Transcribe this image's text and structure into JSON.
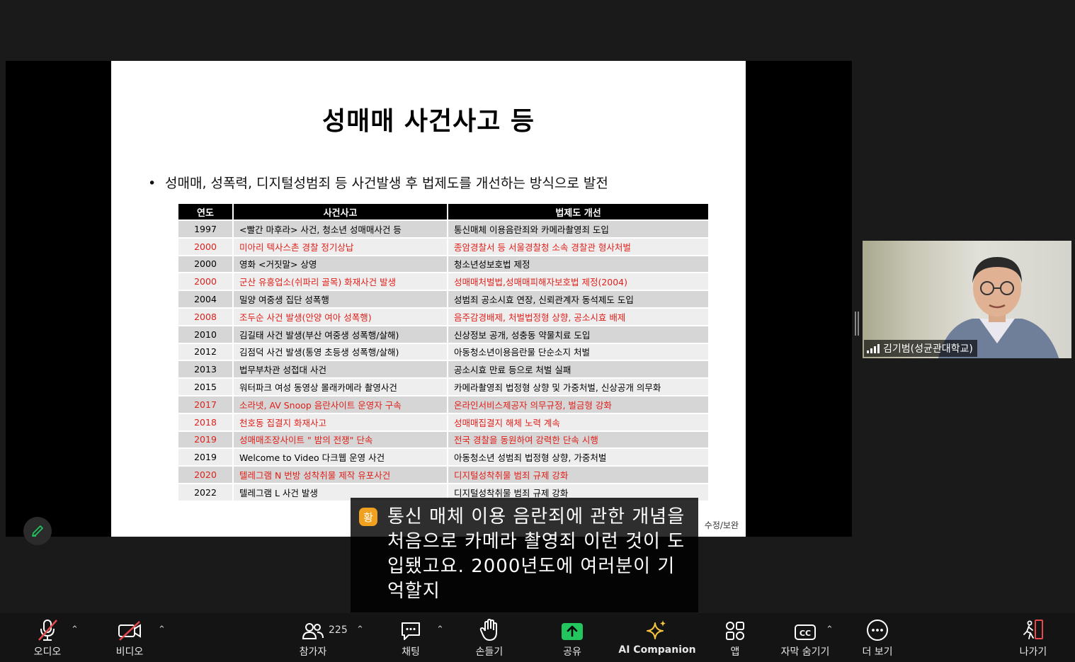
{
  "slide": {
    "title": "성매매 사건사고 등",
    "bullet": "성매매, 성폭력, 디지털성범죄 등 사건발생 후 법제도를 개선하는 방식으로 발전",
    "headers": [
      "연도",
      "사건사고",
      "법제도 개선"
    ],
    "rows": [
      {
        "year": "1997",
        "event": "<빨간 마후라> 사건, 청소년 성매매사건 등",
        "reform": "통신매체 이용음란죄와 카메라촬영죄 도입",
        "highlight": false
      },
      {
        "year": "2000",
        "event": "미아리 텍사스촌 경찰 정기상납",
        "reform": "종암경찰서 등 서울경찰청 소속 경찰관 형사처벌",
        "highlight": true
      },
      {
        "year": "2000",
        "event": "영화 <거짓말> 상영",
        "reform": "청소년성보호법 제정",
        "highlight": false
      },
      {
        "year": "2000",
        "event": "군산 유흥업소(쉬파리 골목) 화재사건 발생",
        "reform": "성매매처벌법,성매매피해자보호법 제정(2004)",
        "highlight": true
      },
      {
        "year": "2004",
        "event": "밀양 여중생 집단 성폭행",
        "reform": "성범죄 공소시효 연장, 신뢰관계자 동석제도  도입",
        "highlight": false
      },
      {
        "year": "2008",
        "event": "조두순 사건 발생(안양 여아 성폭행)",
        "reform": "음주감경배제, 처벌법정형 상향, 공소시효 배제",
        "highlight": true
      },
      {
        "year": "2010",
        "event": "김길태 사건 발생(부산 여중생 성폭행/살해)",
        "reform": "신상정보 공개, 성충동 약물치료 도입",
        "highlight": false
      },
      {
        "year": "2012",
        "event": "김점덕 사건 발생(통영 초등생 성폭행/살해)",
        "reform": "아동청소년이용음란물 단순소지 처벌",
        "highlight": false
      },
      {
        "year": "2013",
        "event": "법무부차관 성접대 사건",
        "reform": "공소시효 만료 등으로 처벌 실패",
        "highlight": false
      },
      {
        "year": "2015",
        "event": "워터파크 여성 동영상 몰래카메라 촬영사건",
        "reform": "카메라촬영죄 법정형 상향 및 가중처벌, 신상공개 의무화",
        "highlight": false
      },
      {
        "year": "2017",
        "event": "소라넷, AV Snoop 음란사이트 운영자 구속",
        "reform": "온라인서비스제공자 의무규정, 벌금형 강화",
        "highlight": true
      },
      {
        "year": "2018",
        "event": "천호동 집결지 화재사고",
        "reform": "성매매집결지 해체 노력 계속",
        "highlight": true
      },
      {
        "year": "2019",
        "event": "성매매조장사이트 \" 밤의 전쟁\" 단속",
        "reform": "전국 경찰을 동원하여 강력한 단속 시행",
        "highlight": true
      },
      {
        "year": "2019",
        "event": "Welcome to Video 다크웹 운영 사건",
        "reform": "아동청소년 성범죄 법정형 상향, 가중처벌",
        "highlight": false
      },
      {
        "year": "2020",
        "event": "텔레그램 N 번방 성착취물 제작 유포사건",
        "reform": "디지털성착취물 범죄 규제 강화",
        "highlight": true
      },
      {
        "year": "2022",
        "event": "텔레그램 L 사건 발생",
        "reform": "디지털성착취물 범죄 규제 강화",
        "highlight": false
      }
    ],
    "footnote": "수정/보완"
  },
  "participant": {
    "name": "김기범(성균관대학교)"
  },
  "caption": {
    "badge": "황",
    "text": "통신 매체 이용 음란죄에 관한 개념을 처음으로 카메라 촬영죄 이런 것이 도입됐고요. 2000년도에 여러분이 기억할지"
  },
  "toolbar": {
    "audio": "오디오",
    "video": "비디오",
    "participants": "참가자",
    "participant_count": "225",
    "chat": "채팅",
    "raise_hand": "손들기",
    "share": "공유",
    "ai_companion": "AI Companion",
    "apps": "앱",
    "captions": "자막 숨기기",
    "more": "더 보기",
    "leave": "나가기"
  },
  "colors": {
    "highlight_red": "#e0201b",
    "share_green": "#22c55e",
    "leave_red": "#e5484d",
    "ai_gold": "#f5c542",
    "muted_red": "#e5484d"
  }
}
